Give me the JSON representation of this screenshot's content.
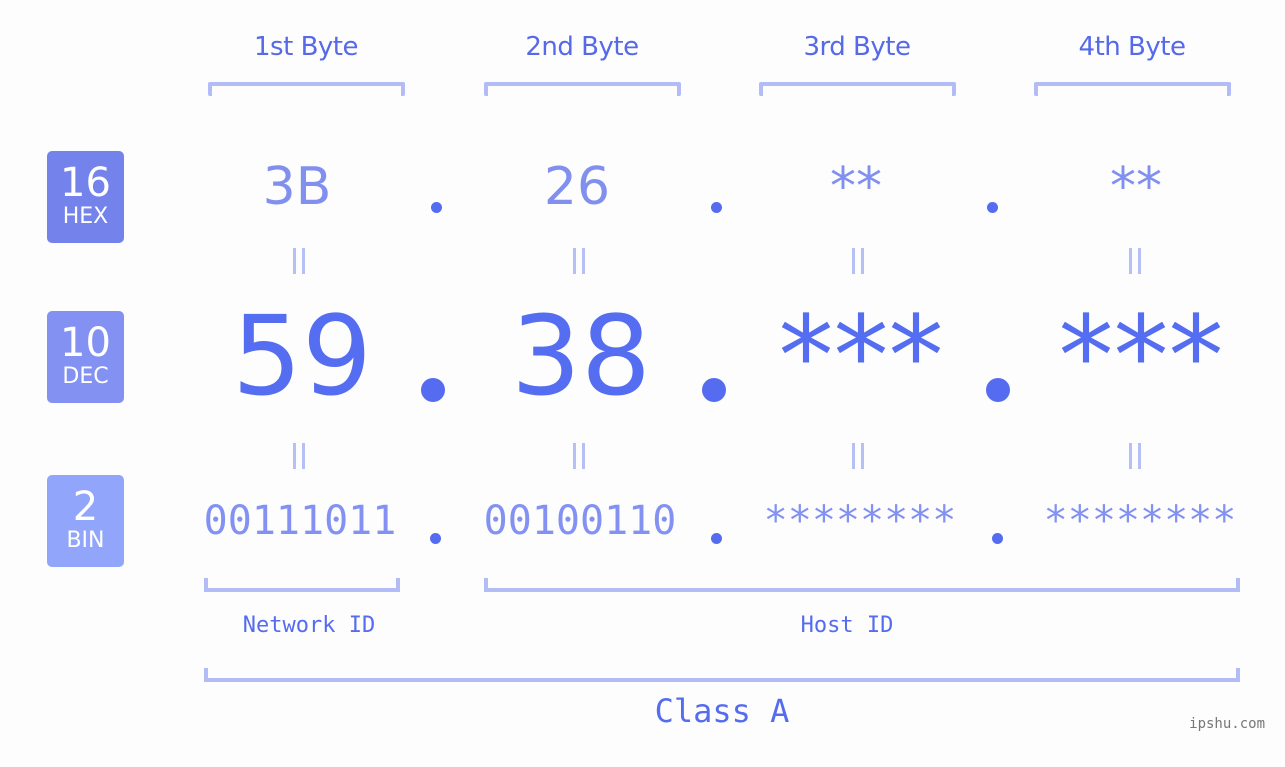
{
  "bytes": [
    {
      "header": "1st Byte",
      "hex": "3B",
      "dec": "59",
      "bin": "00111011"
    },
    {
      "header": "2nd Byte",
      "hex": "26",
      "dec": "38",
      "bin": "00100110"
    },
    {
      "header": "3rd Byte",
      "hex": "**",
      "dec": "***",
      "bin": "********"
    },
    {
      "header": "4th Byte",
      "hex": "**",
      "dec": "***",
      "bin": "********"
    }
  ],
  "radix_badges": {
    "hex": {
      "number": "16",
      "label": "HEX",
      "color": "#7482ec"
    },
    "dec": {
      "number": "10",
      "label": "DEC",
      "color": "#8392f2"
    },
    "bin": {
      "number": "2",
      "label": "BIN",
      "color": "#91a6fa"
    }
  },
  "segments": {
    "network": "Network ID",
    "host": "Host ID"
  },
  "ip_class": "Class A",
  "watermark": "ipshu.com",
  "colors": {
    "accent": "#566cf0",
    "bracket": "#b2bcf6",
    "hex_text": "#8190ef",
    "bin_text": "#8392f2",
    "background": "#fcfdfc"
  }
}
